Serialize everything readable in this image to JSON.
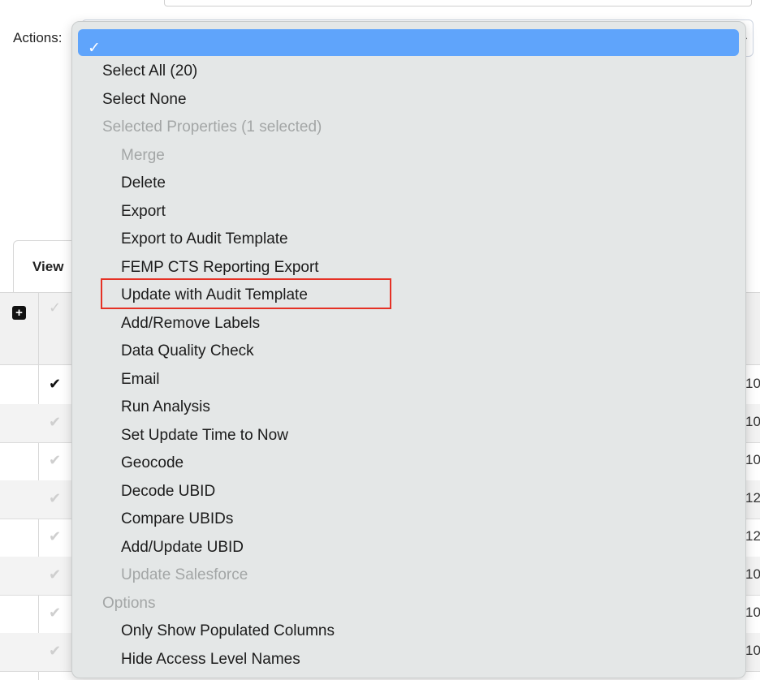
{
  "toolbar": {
    "actions_label": "Actions:"
  },
  "select": {
    "selected_value": "",
    "chevron": "chevron-down-icon"
  },
  "view_tab": {
    "label": "View"
  },
  "grid": {
    "rows": [
      {
        "checked": true,
        "value": "10"
      },
      {
        "checked": false,
        "value": "10"
      },
      {
        "checked": false,
        "value": "10"
      },
      {
        "checked": false,
        "value": "12"
      },
      {
        "checked": false,
        "value": "12"
      },
      {
        "checked": false,
        "value": "10"
      },
      {
        "checked": false,
        "value": "10"
      },
      {
        "checked": false,
        "value": "10"
      }
    ]
  },
  "dropdown": {
    "highlight_color": "#5fa4fb",
    "items": [
      {
        "label": "Select All (20)",
        "level": 1,
        "disabled": false
      },
      {
        "label": "Select None",
        "level": 1,
        "disabled": false
      },
      {
        "label": "Selected Properties (1 selected)",
        "level": 1,
        "disabled": true
      },
      {
        "label": "Merge",
        "level": 2,
        "disabled": true
      },
      {
        "label": "Delete",
        "level": 2,
        "disabled": false
      },
      {
        "label": "Export",
        "level": 2,
        "disabled": false
      },
      {
        "label": "Export to Audit Template",
        "level": 2,
        "disabled": false
      },
      {
        "label": "FEMP CTS Reporting Export",
        "level": 2,
        "disabled": false
      },
      {
        "label": "Update with Audit Template",
        "level": 2,
        "disabled": false,
        "highlighted": true
      },
      {
        "label": "Add/Remove Labels",
        "level": 2,
        "disabled": false
      },
      {
        "label": "Data Quality Check",
        "level": 2,
        "disabled": false
      },
      {
        "label": "Email",
        "level": 2,
        "disabled": false
      },
      {
        "label": "Run Analysis",
        "level": 2,
        "disabled": false
      },
      {
        "label": "Set Update Time to Now",
        "level": 2,
        "disabled": false
      },
      {
        "label": "Geocode",
        "level": 2,
        "disabled": false
      },
      {
        "label": "Decode UBID",
        "level": 2,
        "disabled": false
      },
      {
        "label": "Compare UBIDs",
        "level": 2,
        "disabled": false
      },
      {
        "label": "Add/Update UBID",
        "level": 2,
        "disabled": false
      },
      {
        "label": "Update Salesforce",
        "level": 2,
        "disabled": true
      },
      {
        "label": "Options",
        "level": 1,
        "disabled": true
      },
      {
        "label": "Only Show Populated Columns",
        "level": 2,
        "disabled": false
      },
      {
        "label": "Hide Access Level Names",
        "level": 2,
        "disabled": false
      }
    ]
  }
}
